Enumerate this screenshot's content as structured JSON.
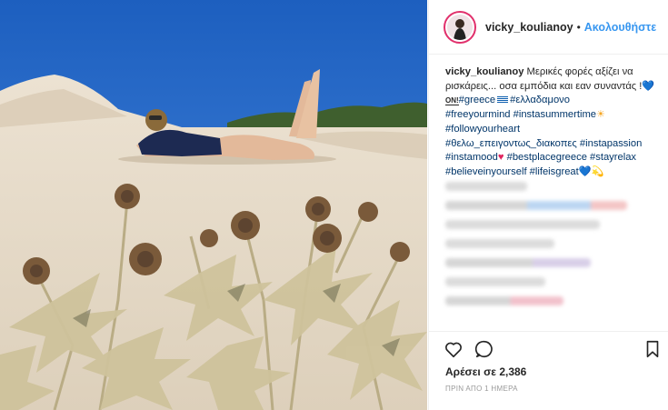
{
  "post": {
    "username": "vicky_koulianoy",
    "separator": "•",
    "follow_label": "Ακολουθήστε"
  },
  "caption": {
    "username": "vicky_koulianoy",
    "text_1": "Μερικές φορές αξίζει να ρισκάρεις... οσα εμπόδια και εαν συναντάς !",
    "tag_greece": "#greece",
    "tag_elladamono": "#ελλαδαμονο",
    "line_3": "#freeyourmind #instasummertime",
    "line_4": "#followyourheart",
    "line_5": "#θελω_επειγοντως_διακοπες #instapassion",
    "line_6a": "#instamood",
    "line_6b": " #bestplacegreece #stayrelax",
    "line_7": "#believeinyourself #lifeisgreat"
  },
  "stats": {
    "likes_text": "Αρέσει σε 2,386",
    "time_text": "ΠΡΙΝ ΑΠΟ 1 ΗΜΕΡΑ"
  },
  "icons": {
    "like": "heart-icon",
    "comment": "comment-icon",
    "save": "bookmark-icon"
  },
  "colors": {
    "link": "#3897f0",
    "hashtag": "#003569",
    "ring": "#e1306c"
  }
}
